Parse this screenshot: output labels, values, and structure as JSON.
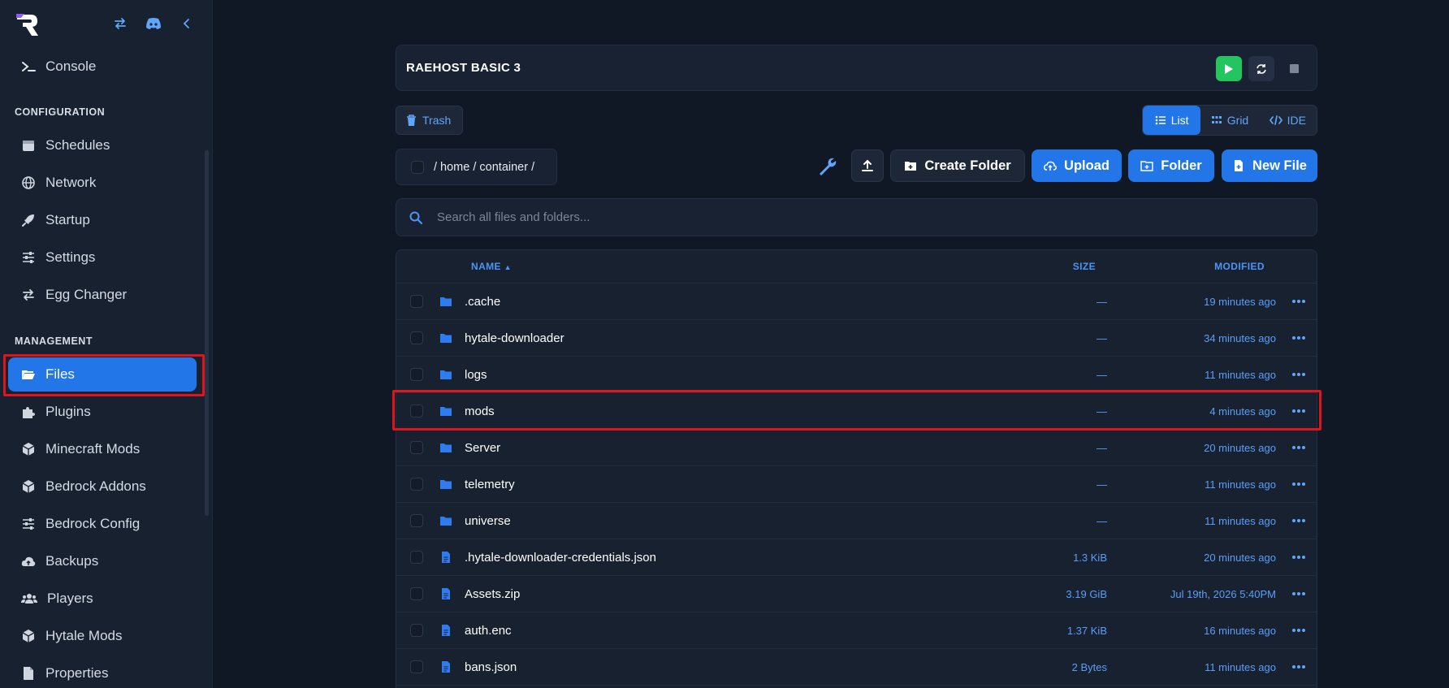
{
  "sidebar": {
    "top_item": "Console",
    "sections": {
      "configuration": "CONFIGURATION",
      "management": "MANAGEMENT"
    },
    "config_items": [
      "Schedules",
      "Network",
      "Startup",
      "Settings",
      "Egg Changer"
    ],
    "management_items": [
      "Files",
      "Plugins",
      "Minecraft Mods",
      "Bedrock Addons",
      "Bedrock Config",
      "Backups",
      "Players",
      "Hytale Mods",
      "Properties"
    ],
    "active_item": "Files"
  },
  "header": {
    "server_name": "RAEHOST BASIC 3"
  },
  "toolbar": {
    "trash_label": "Trash",
    "views": [
      "List",
      "Grid",
      "IDE"
    ],
    "active_view": "List",
    "breadcrumb": "/ home / container /",
    "create_folder_label": "Create Folder",
    "upload_label": "Upload",
    "folder_label": "Folder",
    "new_file_label": "New File"
  },
  "search": {
    "placeholder": "Search all files and folders..."
  },
  "table": {
    "columns": {
      "name": "NAME",
      "size": "SIZE",
      "modified": "MODIFIED"
    },
    "rows": [
      {
        "name": ".cache",
        "type": "folder",
        "size": "—",
        "modified": "19 minutes ago"
      },
      {
        "name": "hytale-downloader",
        "type": "folder",
        "size": "—",
        "modified": "34 minutes ago"
      },
      {
        "name": "logs",
        "type": "folder",
        "size": "—",
        "modified": "11 minutes ago"
      },
      {
        "name": "mods",
        "type": "folder",
        "size": "—",
        "modified": "4 minutes ago"
      },
      {
        "name": "Server",
        "type": "folder",
        "size": "—",
        "modified": "20 minutes ago"
      },
      {
        "name": "telemetry",
        "type": "folder",
        "size": "—",
        "modified": "11 minutes ago"
      },
      {
        "name": "universe",
        "type": "folder",
        "size": "—",
        "modified": "11 minutes ago"
      },
      {
        "name": ".hytale-downloader-credentials.json",
        "type": "file",
        "size": "1.3 KiB",
        "modified": "20 minutes ago"
      },
      {
        "name": "Assets.zip",
        "type": "file",
        "size": "3.19 GiB",
        "modified": "Jul 19th, 2026 5:40PM"
      },
      {
        "name": "auth.enc",
        "type": "file",
        "size": "1.37 KiB",
        "modified": "16 minutes ago"
      },
      {
        "name": "bans.json",
        "type": "file",
        "size": "2 Bytes",
        "modified": "11 minutes ago"
      }
    ]
  },
  "colors": {
    "accent": "#2276e8",
    "link": "#5b9ef7",
    "highlight": "#e0141c",
    "start": "#22c55e"
  }
}
